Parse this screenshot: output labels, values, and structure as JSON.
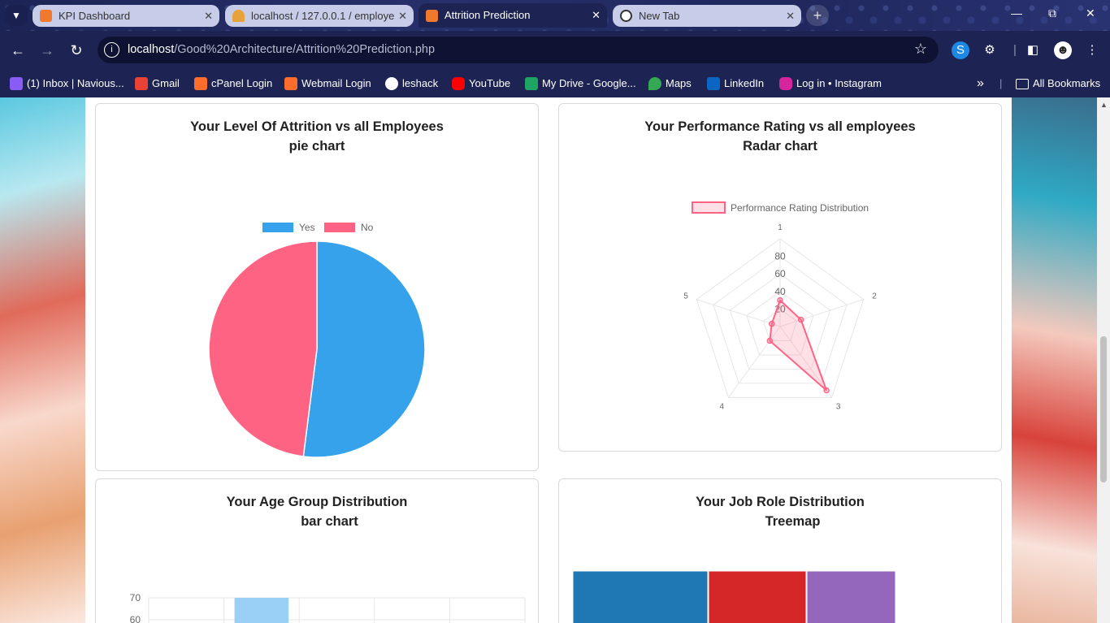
{
  "tabs": [
    {
      "label": "KPI Dashboard",
      "icon": "xampp-icon",
      "active": false
    },
    {
      "label": "localhost / 127.0.0.1 / employee",
      "icon": "phpmyadmin-icon",
      "active": false
    },
    {
      "label": "Attrition Prediction",
      "icon": "xampp-icon",
      "active": true
    },
    {
      "label": "New Tab",
      "icon": "new-tab-icon",
      "active": false
    }
  ],
  "toolbar": {
    "url_host": "localhost",
    "url_path": "/Good%20Architecture/Attrition%20Prediction.php"
  },
  "bookmarks": {
    "items": [
      {
        "label": "(1) Inbox | Navious...",
        "icon": "proton-mail-icon",
        "color": "#8a5cf6"
      },
      {
        "label": "Gmail",
        "icon": "gmail-icon",
        "color": "#ea4335"
      },
      {
        "label": "cPanel Login",
        "icon": "cpanel-icon",
        "color": "#ff6c2c"
      },
      {
        "label": "Webmail Login",
        "icon": "cpanel-icon",
        "color": "#ff6c2c"
      },
      {
        "label": "leshack",
        "icon": "github-icon",
        "color": "#ffffff"
      },
      {
        "label": "YouTube",
        "icon": "youtube-icon",
        "color": "#ff0000"
      },
      {
        "label": "My Drive - Google...",
        "icon": "google-drive-icon",
        "color": "#1fa463"
      },
      {
        "label": "Maps",
        "icon": "google-maps-icon",
        "color": "#34a853"
      },
      {
        "label": "LinkedIn",
        "icon": "linkedin-icon",
        "color": "#0a66c2"
      },
      {
        "label": "Log in • Instagram",
        "icon": "instagram-icon",
        "color": "#d6249f"
      }
    ],
    "more": "»",
    "all_bookmarks": "All Bookmarks"
  },
  "cards": {
    "attrition": {
      "title": "Your Level Of Attrition vs all Employees",
      "subtitle": "pie chart"
    },
    "performance": {
      "title": "Your Performance Rating vs all employees",
      "subtitle": "Radar chart"
    },
    "age": {
      "title": "Your Age Group Distribution",
      "subtitle": "bar chart"
    },
    "jobrole": {
      "title": "Your Job Role Distribution",
      "subtitle": "Treemap"
    }
  },
  "chart_data": [
    {
      "type": "pie",
      "legend": [
        "Yes",
        "No"
      ],
      "values": [
        52,
        48
      ],
      "colors": [
        "#36a2eb",
        "#ff6384"
      ]
    },
    {
      "type": "radar",
      "legend": [
        "Performance Rating Distribution"
      ],
      "labels": [
        "1",
        "2",
        "3",
        "4",
        "5"
      ],
      "values": [
        30,
        25,
        90,
        20,
        10
      ],
      "ticks": [
        "20",
        "40",
        "60",
        "80"
      ],
      "rmax": 100,
      "color": "#ff6384"
    },
    {
      "type": "bar",
      "yticks": [
        "70",
        "60"
      ],
      "visible_bar_value": 70,
      "color": "#9ad0f5"
    },
    {
      "type": "treemap",
      "colors": [
        "#1f77b4",
        "#d62728",
        "#9467bd"
      ]
    }
  ]
}
